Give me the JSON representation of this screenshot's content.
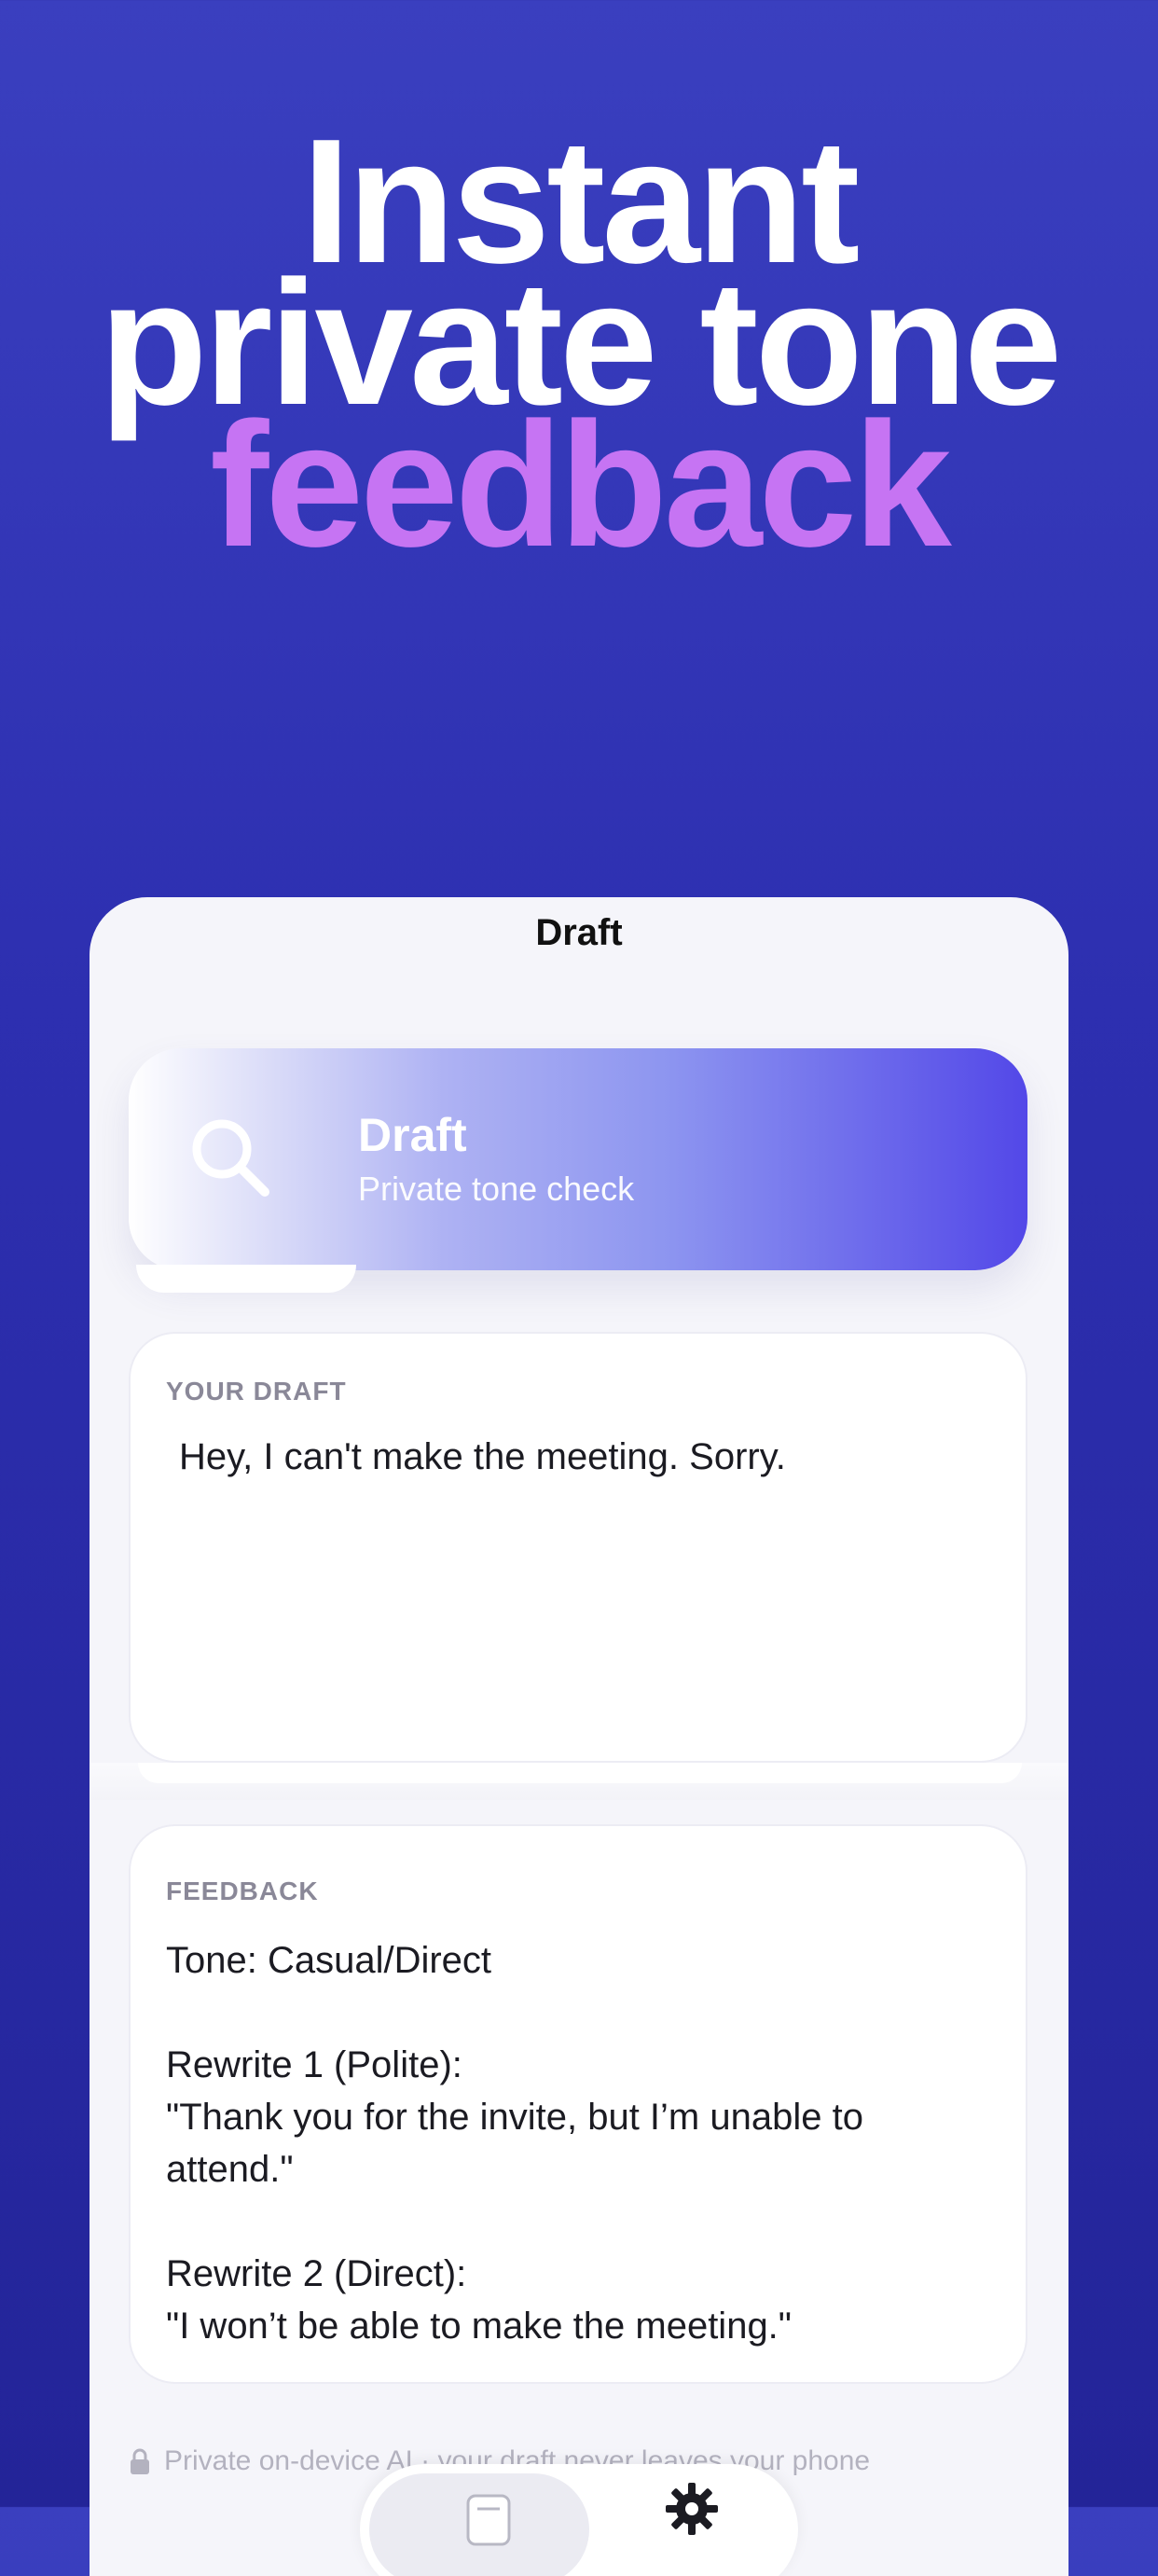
{
  "headline": {
    "line1": "Instant",
    "line2": "private tone",
    "line3": "feedback"
  },
  "nav": {
    "title": "Draft"
  },
  "hero": {
    "icon": "search-icon",
    "title": "Draft",
    "subtitle": "Private tone check"
  },
  "draft": {
    "label": "YOUR DRAFT",
    "text": "Hey, I can't make the meeting. Sorry."
  },
  "feedback": {
    "label": "FEEDBACK",
    "body": "Tone: Casual/Direct\n\nRewrite 1 (Polite):\n\"Thank you for the invite, but I’m unable to attend.\"\n\nRewrite 2 (Direct):\n\"I won’t be able to make the meeting.\""
  },
  "footer": {
    "privacy_icon": "lock-icon",
    "privacy_text": "Private on-device AI · your draft never leaves your phone"
  },
  "tabbar": {
    "tabs": [
      {
        "icon": "document-icon",
        "selected": true
      },
      {
        "icon": "gear-icon",
        "selected": false
      }
    ]
  },
  "colors": {
    "background_top": "#3a3fbf",
    "background_bottom": "#232498",
    "headline_accent": "#c674f3",
    "hero_gradient_end": "#5348e8"
  }
}
